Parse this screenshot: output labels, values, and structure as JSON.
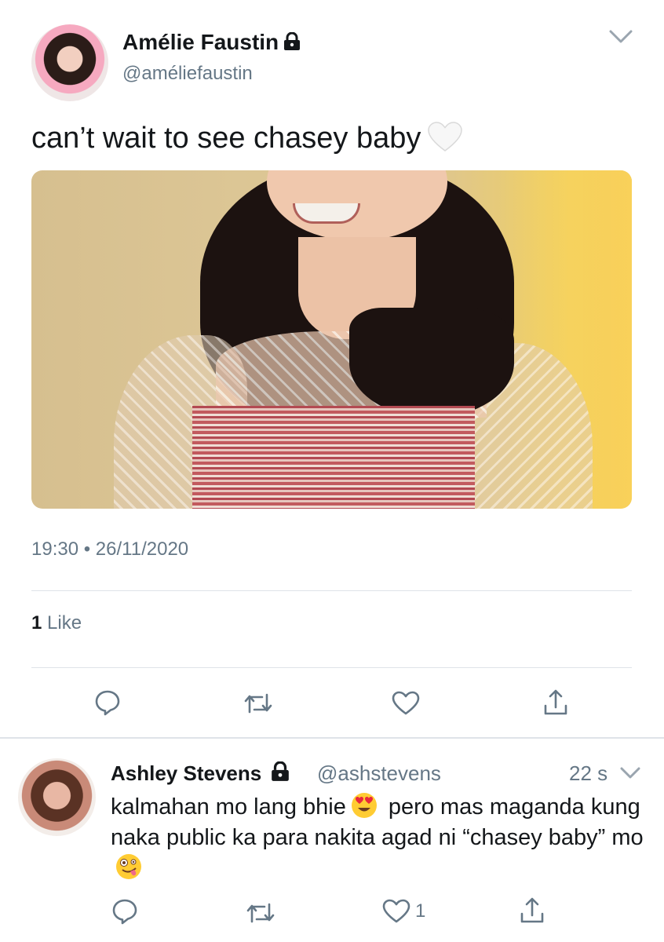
{
  "main_tweet": {
    "author_name": "Amélie Faustin",
    "author_handle": "@améliefaustin",
    "text": "can’t wait to see chasey baby",
    "timestamp": "19:30 • 26/11/2020",
    "likes_count": "1",
    "likes_label": "Like",
    "icons": {
      "lock": "lock-icon",
      "chevron": "chevron-down-icon",
      "text_emoji": "white-heart-emoji",
      "reply": "reply-icon",
      "retweet": "retweet-icon",
      "like": "heart-icon",
      "share": "share-icon"
    }
  },
  "reply_tweet": {
    "author_name": "Ashley Stevens",
    "author_handle": "@ashstevens",
    "time": "22 s",
    "text_part1": "kalmahan mo lang bhie",
    "text_part2": "pero mas maganda kung naka public ka para nakita agad ni “chasey baby” mo",
    "emoji_1": "heart-eyes-emoji",
    "emoji_2": "zany-face-emoji",
    "like_count": "1"
  },
  "colors": {
    "text_primary": "#14171a",
    "text_secondary": "#657786",
    "divider": "#dfe3e8",
    "icon": "#657786"
  }
}
